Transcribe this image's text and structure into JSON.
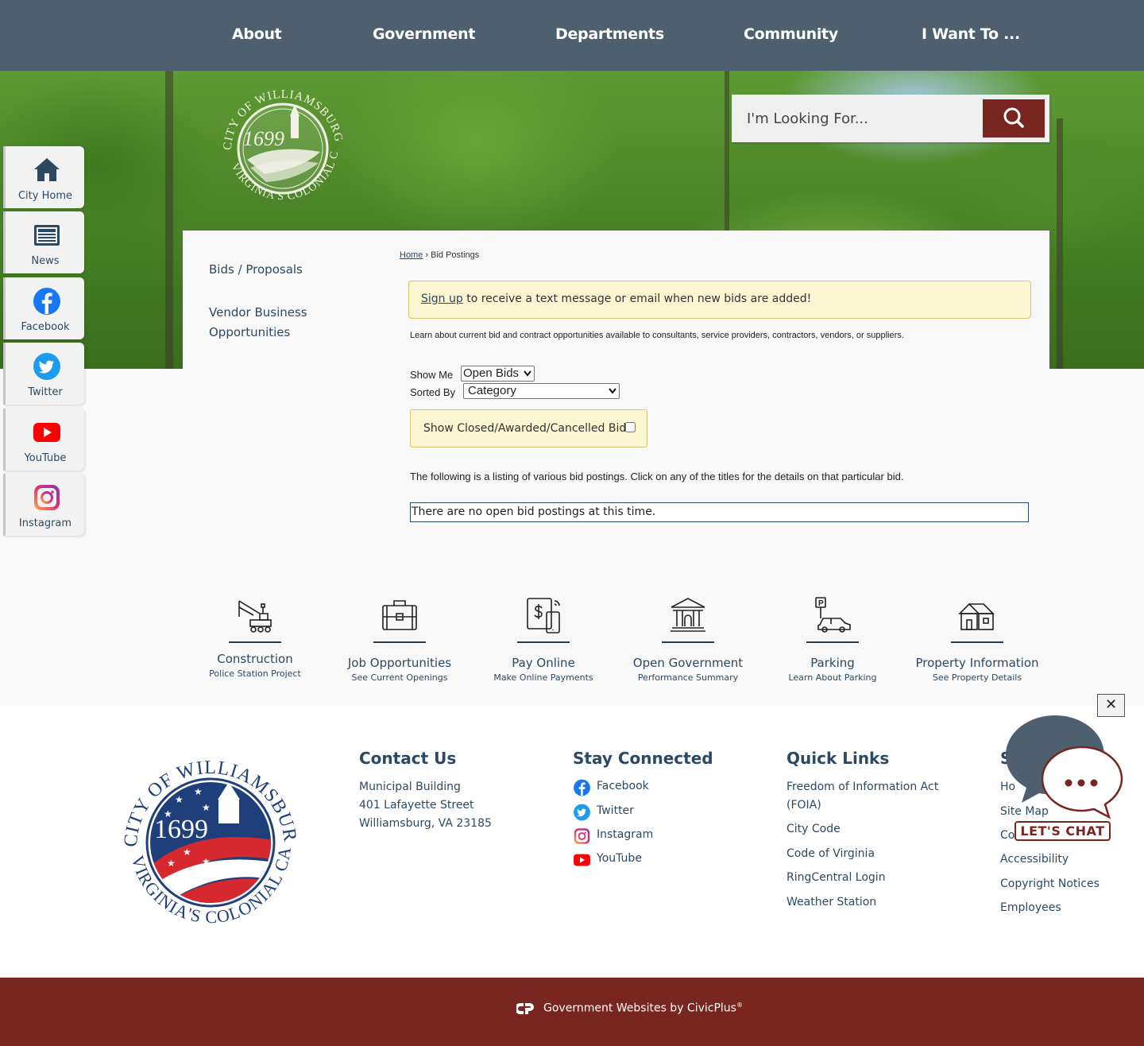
{
  "nav": {
    "items": [
      "About",
      "Government",
      "Departments",
      "Community",
      "I Want To ..."
    ]
  },
  "logo": {
    "year": "1699",
    "ring_text": "CITY OF WILLIAMSBURG · VIRGINIA'S COLONIAL CAPITAL"
  },
  "search": {
    "placeholder": "I'm Looking For..."
  },
  "sidebar": {
    "items": [
      {
        "label": "City Home",
        "icon": "home-icon"
      },
      {
        "label": "News",
        "icon": "newspaper-icon"
      },
      {
        "label": "Facebook",
        "icon": "facebook-icon"
      },
      {
        "label": "Twitter",
        "icon": "twitter-icon"
      },
      {
        "label": "YouTube",
        "icon": "youtube-icon"
      },
      {
        "label": "Instagram",
        "icon": "instagram-icon"
      }
    ]
  },
  "subnav": {
    "bids": "Bids / Proposals",
    "vendor_line1": "Vendor Business",
    "vendor_line2": "Opportunities"
  },
  "breadcrumb": {
    "home": "Home",
    "separator": "›",
    "current": "Bid Postings"
  },
  "alert": {
    "link": "Sign up",
    "text": " to receive a text message or email when new bids are added!"
  },
  "intro": "Learn about current bid and contract opportunities available to consultants, service providers, contractors, vendors, or suppliers.",
  "filters": {
    "show_me_label": "Show Me",
    "show_me_value": "Open Bids",
    "sorted_by_label": "Sorted By",
    "sorted_by_value": "Category",
    "closed_label": "Show Closed/Awarded/Cancelled Bids:"
  },
  "listing_text": "The following is a listing of various bid postings. Click on any of the titles for the details on that particular bid.",
  "no_bids": "There are no open bid postings at this time.",
  "tiles": [
    {
      "title": "Construction",
      "sub": "Police Station Project",
      "icon": "crane-icon"
    },
    {
      "title": "Job Opportunities",
      "sub": "See Current Openings",
      "icon": "briefcase-icon"
    },
    {
      "title": "Pay Online",
      "sub": "Make Online Payments",
      "icon": "payment-icon"
    },
    {
      "title": "Open Government",
      "sub": "Performance Summary",
      "icon": "government-building-icon"
    },
    {
      "title": "Parking",
      "sub": "Learn About Parking",
      "icon": "parking-car-icon"
    },
    {
      "title": "Property Information",
      "sub": "See Property Details",
      "icon": "house-icon"
    }
  ],
  "footer": {
    "contact": {
      "heading": "Contact Us",
      "line1": "Municipal Building",
      "line2": "401 Lafayette Street",
      "line3": "Williamsburg, VA 23185"
    },
    "stay_connected": {
      "heading": "Stay Connected",
      "items": [
        "Facebook",
        "Twitter",
        "Instagram",
        "YouTube"
      ]
    },
    "quick_links": {
      "heading": "Quick Links",
      "items": [
        "Freedom of Information Act",
        "(FOIA)",
        "City Code",
        "Code of Virginia",
        "RingCentral Login",
        "Weather Station"
      ]
    },
    "site_links": {
      "heading": "S",
      "items": [
        "Ho",
        "Site Map",
        "Co",
        "Accessibility",
        "Copyright Notices",
        "Employees"
      ]
    }
  },
  "chat": {
    "close": "✕",
    "label": "LET'S CHAT"
  },
  "bottom": {
    "text": "Government Websites by CivicPlus",
    "reg": "®"
  },
  "colors": {
    "nav_bg": "#4e6070",
    "accent": "#7a2620",
    "link": "#2c4963",
    "alert_bg": "#fcf5d1"
  }
}
